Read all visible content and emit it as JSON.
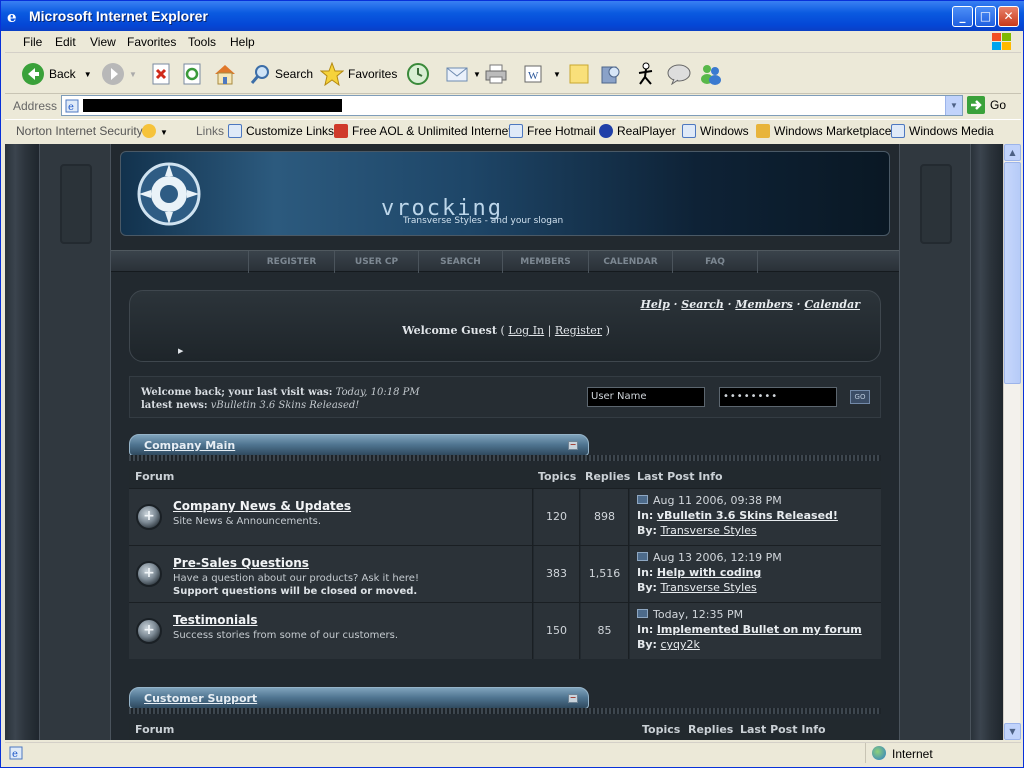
{
  "window": {
    "title": "Microsoft Internet Explorer"
  },
  "menu": [
    "File",
    "Edit",
    "View",
    "Favorites",
    "Tools",
    "Help"
  ],
  "toolbar": {
    "back": "Back",
    "search": "Search",
    "favorites": "Favorites"
  },
  "address": {
    "label": "Address",
    "go": "Go"
  },
  "links_bar": {
    "norton": "Norton Internet Security",
    "links_label": "Links",
    "items": [
      "Customize Links",
      "Free AOL & Unlimited Internet",
      "Free Hotmail",
      "RealPlayer",
      "Windows",
      "Windows Marketplace",
      "Windows Media"
    ]
  },
  "status": {
    "zone": "Internet"
  },
  "site": {
    "banner_logo": "vrocking",
    "banner_slogan": "Transverse Styles - and your slogan",
    "nav": [
      "REGISTER",
      "USER CP",
      "SEARCH",
      "MEMBERS",
      "CALENDAR",
      "FAQ"
    ],
    "toplinks": [
      "Help",
      "Search",
      "Members",
      "Calendar"
    ],
    "welcome": {
      "prefix": "Welcome Guest",
      "open": "(",
      "login": "Log In",
      "sep": "|",
      "register": "Register",
      "close": ")"
    },
    "lastvisit_label": "Welcome back; your last visit was:",
    "lastvisit_value": "Today, 10:18 PM",
    "news_label": "latest news:",
    "news_value": "vBulletin 3.6 Skins Released!",
    "username_placeholder": "User Name",
    "password_mask": "••••••••",
    "go": "GO"
  },
  "categories": [
    {
      "title": "Company Main",
      "columns": [
        "Forum",
        "Topics",
        "Replies",
        "Last Post Info"
      ],
      "forums": [
        {
          "name": "Company News & Updates",
          "desc": "Site News & Announcements.",
          "desc2": "",
          "topics": "120",
          "replies": "898",
          "lp_date": "Aug 11 2006, 09:38 PM",
          "lp_in_label": "In:",
          "lp_in": "vBulletin 3.6 Skins Released!",
          "lp_by_label": "By:",
          "lp_by": "Transverse Styles"
        },
        {
          "name": "Pre-Sales Questions",
          "desc": "Have a question about our products? Ask it here!",
          "desc2": "Support questions will be closed or moved.",
          "topics": "383",
          "replies": "1,516",
          "lp_date": "Aug 13 2006, 12:19 PM",
          "lp_in_label": "In:",
          "lp_in": "Help with coding",
          "lp_by_label": "By:",
          "lp_by": "Transverse Styles"
        },
        {
          "name": "Testimonials",
          "desc": "Success stories from some of our customers.",
          "desc2": "",
          "topics": "150",
          "replies": "85",
          "lp_date": "Today, 12:35 PM",
          "lp_in_label": "In:",
          "lp_in": "Implemented Bullet on my forum",
          "lp_by_label": "By:",
          "lp_by": "cyqy2k"
        }
      ]
    },
    {
      "title": "Customer Support",
      "columns": [
        "Forum",
        "Topics",
        "Replies",
        "Last Post Info"
      ]
    }
  ]
}
